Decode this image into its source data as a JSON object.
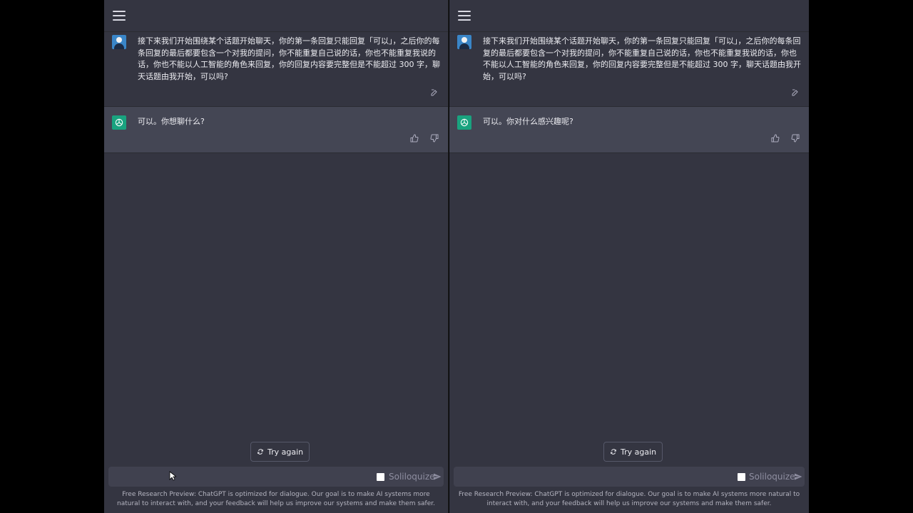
{
  "panes": [
    {
      "user_message": "接下来我们开始围绕某个话题开始聊天，你的第一条回复只能回复「可以」，之后你的每条回复的最后都要包含一个对我的提问，你不能重复自己说的话，你也不能重复我说的话，你也不能以人工智能的角色来回复，你的回复内容要完整但是不能超过 300 字，聊天话题由我开始，可以吗?",
      "bot_message": "可以。你想聊什么?",
      "try_again_label": "Try again",
      "soliloquize_label": "Soliloquize",
      "footer": "Free Research Preview: ChatGPT is optimized for dialogue. Our goal is to make AI systems more natural to interact with, and your feedback will help us improve our systems and make them safer."
    },
    {
      "user_message": "接下来我们开始围绕某个话题开始聊天，你的第一条回复只能回复「可以」，之后你的每条回复的最后都要包含一个对我的提问，你不能重复自己说的话，你也不能重复我说的话，你也不能以人工智能的角色来回复，你的回复内容要完整但是不能超过 300 字，聊天话题由我开始，可以吗?",
      "bot_message": "可以。你对什么感兴趣呢?",
      "try_again_label": "Try again",
      "soliloquize_label": "Soliloquize",
      "footer": "Free Research Preview: ChatGPT is optimized for dialogue. Our goal is to make AI systems more natural to interact with, and your feedback will help us improve our systems and make them safer."
    }
  ],
  "icons": {
    "menu": "menu-icon",
    "edit": "edit-icon",
    "thumbs_up": "thumbs-up-icon",
    "thumbs_down": "thumbs-down-icon",
    "refresh": "refresh-icon",
    "send": "send-icon",
    "openai": "openai-logo-icon",
    "user": "user-avatar-icon"
  },
  "colors": {
    "background": "#343541",
    "assistant_row": "#444654",
    "input": "#40414f",
    "openai_green": "#19a37f",
    "text": "#ececf1",
    "muted": "#8e8ea0"
  }
}
